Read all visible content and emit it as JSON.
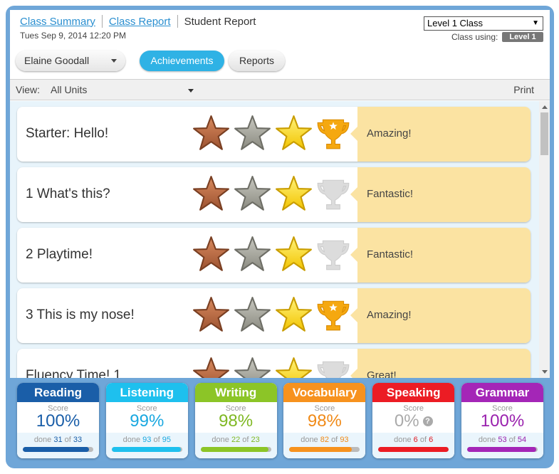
{
  "nav": {
    "class_summary": "Class Summary",
    "class_report": "Class Report",
    "student_report": "Student Report",
    "date": "Tues Sep 9, 2014 12:20 PM"
  },
  "class_select": {
    "value": "Level 1 Class",
    "using_label": "Class using:",
    "using_value": "Level 1"
  },
  "student": {
    "name": "Elaine Goodall"
  },
  "tabs": {
    "achievements": "Achievements",
    "reports": "Reports"
  },
  "viewbar": {
    "view_label": "View:",
    "view_value": "All Units",
    "print": "Print"
  },
  "units": [
    {
      "title": "Starter: Hello!",
      "trophy": true,
      "message": "Amazing!"
    },
    {
      "title": "1 What's this?",
      "trophy": false,
      "message": "Fantastic!"
    },
    {
      "title": "2 Playtime!",
      "trophy": false,
      "message": "Fantastic!"
    },
    {
      "title": "3 This is my nose!",
      "trophy": true,
      "message": "Amazing!"
    },
    {
      "title": "Fluency Time! 1",
      "trophy": false,
      "message": "Great!"
    }
  ],
  "skills": [
    {
      "name": "Reading",
      "score_label": "Score",
      "score": "100%",
      "done_label": "done",
      "done": "31",
      "of_label": "of",
      "total": "33",
      "progress": 0.94,
      "color": "#1a5ea8",
      "score_color": "#1a5ea8",
      "done_color": "#1a5ea8"
    },
    {
      "name": "Listening",
      "score_label": "Score",
      "score": "99%",
      "done_label": "done",
      "done": "93",
      "of_label": "of",
      "total": "95",
      "progress": 0.98,
      "color": "#1ec0ee",
      "score_color": "#1aa8e0",
      "done_color": "#1aa8e0"
    },
    {
      "name": "Writing",
      "score_label": "Score",
      "score": "98%",
      "done_label": "done",
      "done": "22",
      "of_label": "of",
      "total": "23",
      "progress": 0.96,
      "color": "#8cc527",
      "score_color": "#7fb823",
      "done_color": "#7fb823"
    },
    {
      "name": "Vocabulary",
      "score_label": "Score",
      "score": "98%",
      "done_label": "done",
      "done": "82",
      "of_label": "of",
      "total": "93",
      "progress": 0.88,
      "color": "#f7921e",
      "score_color": "#f08a18",
      "done_color": "#f08a18"
    },
    {
      "name": "Speaking",
      "score_label": "Score",
      "score": "0%",
      "done_label": "done",
      "done": "6",
      "of_label": "of",
      "total": "6",
      "progress": 1.0,
      "color": "#ec1c24",
      "score_color": "#aaaaaa",
      "done_color": "#e01a22",
      "help": "?"
    },
    {
      "name": "Grammar",
      "score_label": "Score",
      "score": "100%",
      "done_label": "done",
      "done": "53",
      "of_label": "of",
      "total": "54",
      "progress": 0.98,
      "color": "#a426b7",
      "score_color": "#9a22ae",
      "done_color": "#9a22ae"
    }
  ]
}
